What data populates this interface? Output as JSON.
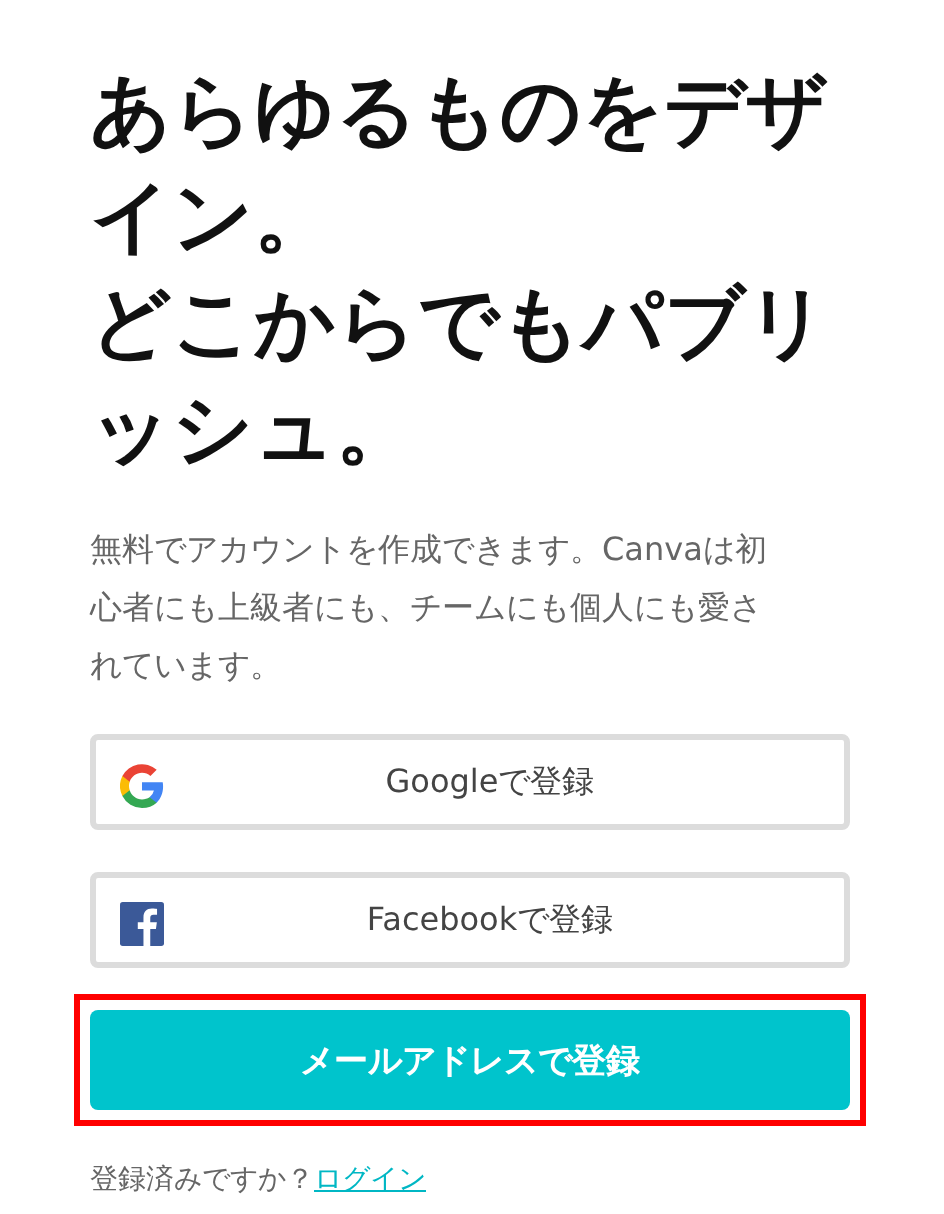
{
  "headline": [
    "あらゆるものをデザイン。",
    "どこからでもパブリッシュ。"
  ],
  "description": "無料でアカウントを作成できます。Canvaは初心者にも上級者にも、チームにも個人にも愛されています。",
  "buttons": [
    {
      "kind": "google",
      "label": "Googleで登録",
      "highlighted": false
    },
    {
      "kind": "facebook",
      "label": "Facebookで登録",
      "highlighted": false
    },
    {
      "kind": "email",
      "label": "メールアドレスで登録",
      "highlighted": true
    }
  ],
  "footer": {
    "text": "登録済みですか？",
    "link": "ログイン"
  }
}
